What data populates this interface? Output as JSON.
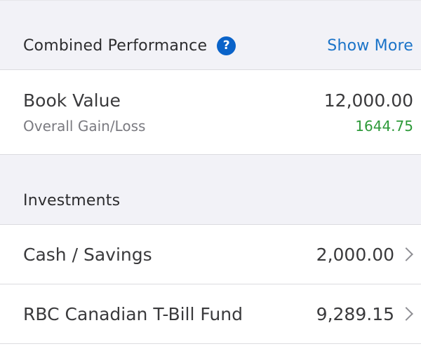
{
  "combined_performance": {
    "title": "Combined Performance",
    "help_icon": "question-mark-icon",
    "show_more_label": "Show More",
    "accent_color": "#0a63c9"
  },
  "book_value": {
    "label": "Book Value",
    "value": "12,000.00",
    "gain_loss_label": "Overall Gain/Loss",
    "gain_loss_value": "1644.75",
    "gain_color": "#2e9a3a"
  },
  "investments": {
    "title": "Investments",
    "items": [
      {
        "label": "Cash / Savings",
        "value": "2,000.00",
        "icon": "chevron-right-icon"
      },
      {
        "label": "RBC Canadian T-Bill Fund",
        "value": "9,289.15",
        "icon": "chevron-right-icon"
      }
    ]
  }
}
